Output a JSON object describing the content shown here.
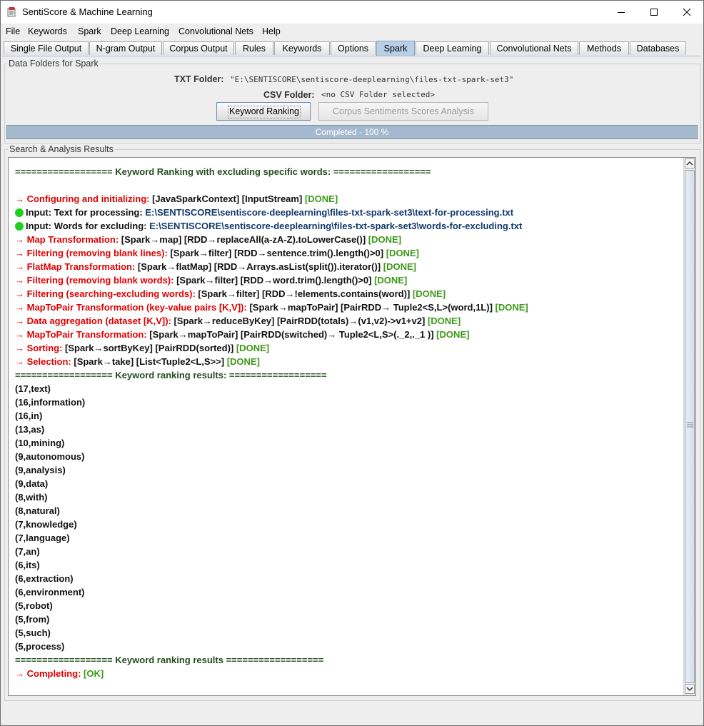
{
  "window": {
    "title": "SentiScore & Machine Learning",
    "minimize_icon": "minimize-icon",
    "maximize_icon": "maximize-icon",
    "close_icon": "close-icon"
  },
  "menu": [
    "File",
    "Keywords",
    "Spark",
    "Deep Learning",
    "Convolutional Nets",
    "Help"
  ],
  "tabs": [
    "Single File Output",
    "N-gram Output",
    "Corpus Output",
    "Rules",
    "Keywords",
    "Options",
    "Spark",
    "Deep Learning",
    "Convolutional Nets",
    "Methods",
    "Databases"
  ],
  "active_tab": "Spark",
  "folders": {
    "group_title": "Data Folders for Spark",
    "txt_label": "TXT Folder:",
    "txt_value": "\"E:\\SENTISCORE\\sentiscore-deeplearning\\files-txt-spark-set3\"",
    "csv_label": "CSV Folder:",
    "csv_value": "<no CSV Folder selected>",
    "keyword_button": "Keyword Ranking",
    "corpus_button": "Corpus Sentiments Scores Analysis",
    "progress_text": "Completed - 100 %",
    "progress_value": 100
  },
  "results": {
    "group_title": "Search & Analysis Results",
    "header": "================== Keyword Ranking with excluding specific words: ==================",
    "steps": [
      {
        "label": "→ Configuring and initializing:",
        "detail": " [JavaSparkContext] [InputStream]",
        "status": " [DONE]"
      },
      {
        "label": "Input:",
        "detail": "  Text for processing:",
        "path": "   E:\\SENTISCORE\\sentiscore-deeplearning\\files-txt-spark-set3\\text-for-processing.txt",
        "dot": true
      },
      {
        "label": "Input:",
        "detail": "  Words for excluding:",
        "path": "   E:\\SENTISCORE\\sentiscore-deeplearning\\files-txt-spark-set3\\words-for-excluding.txt",
        "dot": true
      },
      {
        "label": "→ Map Transformation:",
        "detail": " [Spark→map] [RDD→replaceAll(a-zA-Z).toLowerCase()]",
        "status": " [DONE]"
      },
      {
        "label": "→ Filtering (removing blank lines):",
        "detail": " [Spark→filter] [RDD→sentence.trim().length()>0]",
        "status": " [DONE]"
      },
      {
        "label": "→ FlatMap Transformation:",
        "detail": " [Spark→flatMap] [RDD→Arrays.asList(split()).iterator()]",
        "status": " [DONE]"
      },
      {
        "label": "→ Filtering (removing blank words):",
        "detail": " [Spark→filter] [RDD→word.trim().length()>0]",
        "status": " [DONE]"
      },
      {
        "label": "→ Filtering (searching-excluding words):",
        "detail": " [Spark→filter] [RDD→!elements.contains(word)]",
        "status": " [DONE]"
      },
      {
        "label": "→ MapToPair Transformation (key-value pairs [K,V]):",
        "detail": " [Spark→mapToPair] [PairRDD→ Tuple2<S,L>(word,1L)]",
        "status": " [DONE]"
      },
      {
        "label": "→ Data aggregation (dataset [K,V]):",
        "detail": " [Spark→reduceByKey] [PairRDD(totals)→(v1,v2)->v1+v2]",
        "status": " [DONE]"
      },
      {
        "label": "→ MapToPair Transformation:",
        "detail": " [Spark→mapToPair] [PairRDD(switched)→ Tuple2<L,S>(._2,._1 )]",
        "status": " [DONE]"
      },
      {
        "label": "→ Sorting:",
        "detail": " [Spark→sortByKey] [PairRDD(sorted)]",
        "status": " [DONE]"
      },
      {
        "label": "→  Selection:",
        "detail": " [Spark→take] [List<Tuple2<L,S>>]",
        "status": " [DONE]"
      }
    ],
    "ranking_header": "================== Keyword ranking results: ==================",
    "ranking": [
      "(17,text)",
      "(16,information)",
      "(16,in)",
      "(13,as)",
      "(10,mining)",
      "(9,autonomous)",
      "(9,analysis)",
      "(9,data)",
      "(8,with)",
      "(8,natural)",
      "(7,knowledge)",
      "(7,language)",
      "(7,an)",
      "(6,its)",
      "(6,extraction)",
      "(6,environment)",
      "(5,robot)",
      "(5,from)",
      "(5,such)",
      "(5,process)"
    ],
    "ranking_footer": "================== Keyword ranking results ==================",
    "completing_label": "→ Completing:",
    "completing_status": "  [OK]"
  },
  "colors": {
    "accent_tab": "#b8cfe5",
    "progress": "#a5b9ce",
    "error_red": "#e00000",
    "done_green": "#3c9a18",
    "path_navy": "#123a6e"
  }
}
